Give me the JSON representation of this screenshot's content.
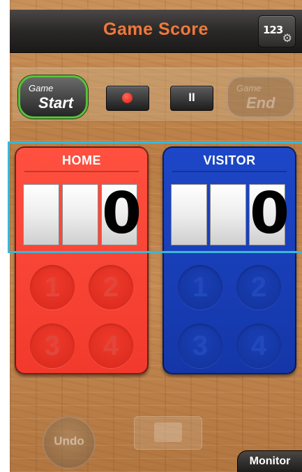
{
  "header": {
    "title": "Game Score",
    "settings_digits": "123",
    "settings_icon": "gear-icon"
  },
  "controls": {
    "start": {
      "small": "Game",
      "big": "Start"
    },
    "end": {
      "small": "Game",
      "big": "End"
    },
    "record_icon": "record-dot-icon",
    "pause_glyph": "II"
  },
  "home": {
    "label": "HOME",
    "digits": [
      "",
      "",
      "0"
    ],
    "buttons": [
      "1",
      "2",
      "3",
      "4"
    ],
    "color": "#f23a2c"
  },
  "visitor": {
    "label": "VISITOR",
    "digits": [
      "",
      "",
      "0"
    ],
    "buttons": [
      "1",
      "2",
      "3",
      "4"
    ],
    "color": "#1436a8"
  },
  "footer": {
    "undo_label": "Undo",
    "monitor_label": "Monitor"
  },
  "colors": {
    "title": "#f2783a",
    "start_border": "#57c23a",
    "highlight": "#3ab7d8"
  }
}
